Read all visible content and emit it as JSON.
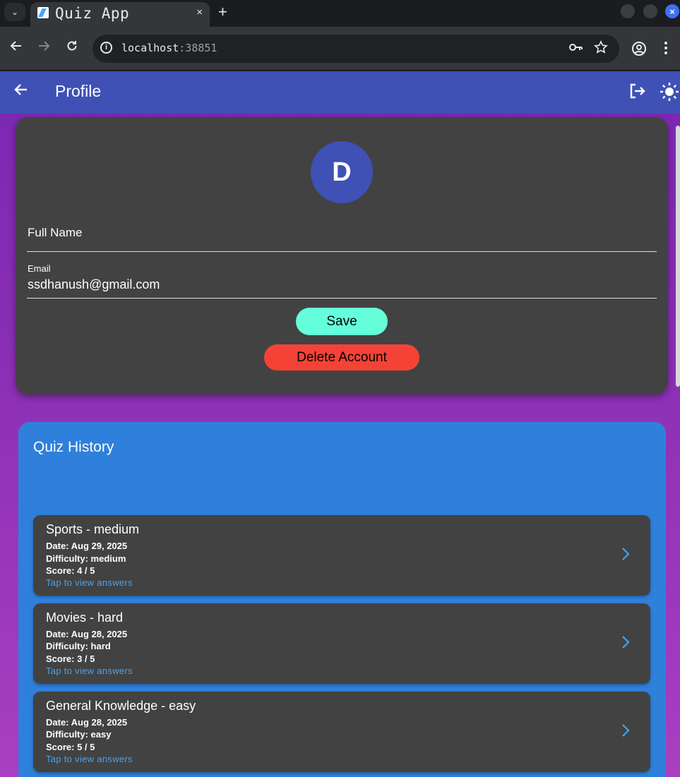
{
  "browser": {
    "tab_title": "Quiz App",
    "tab_close": "×",
    "new_tab": "+",
    "url_host": "localhost",
    "url_port": ":38851"
  },
  "app": {
    "title": "Profile",
    "colors": {
      "primary": "#3f51b5",
      "accent": "#64ffda",
      "danger": "#f44336",
      "history_bg": "#2f80db",
      "card_bg": "#424242"
    }
  },
  "profile": {
    "avatar_letter": "D",
    "full_name_label": "Full Name",
    "full_name_value": "",
    "email_label": "Email",
    "email_value": "ssdhanush@gmail.com",
    "save_label": "Save",
    "delete_label": "Delete Account"
  },
  "history": {
    "title": "Quiz History",
    "items": [
      {
        "title": "Sports - medium",
        "date": "Date: Aug 29, 2025",
        "difficulty": "Difficulty: medium",
        "score": "Score: 4 / 5",
        "link": "Tap to view answers"
      },
      {
        "title": "Movies - hard",
        "date": "Date: Aug 28, 2025",
        "difficulty": "Difficulty: hard",
        "score": "Score: 3 / 5",
        "link": "Tap to view answers"
      },
      {
        "title": "General Knowledge - easy",
        "date": "Date: Aug 28, 2025",
        "difficulty": "Difficulty: easy",
        "score": "Score: 5 / 5",
        "link": "Tap to view answers"
      }
    ]
  }
}
